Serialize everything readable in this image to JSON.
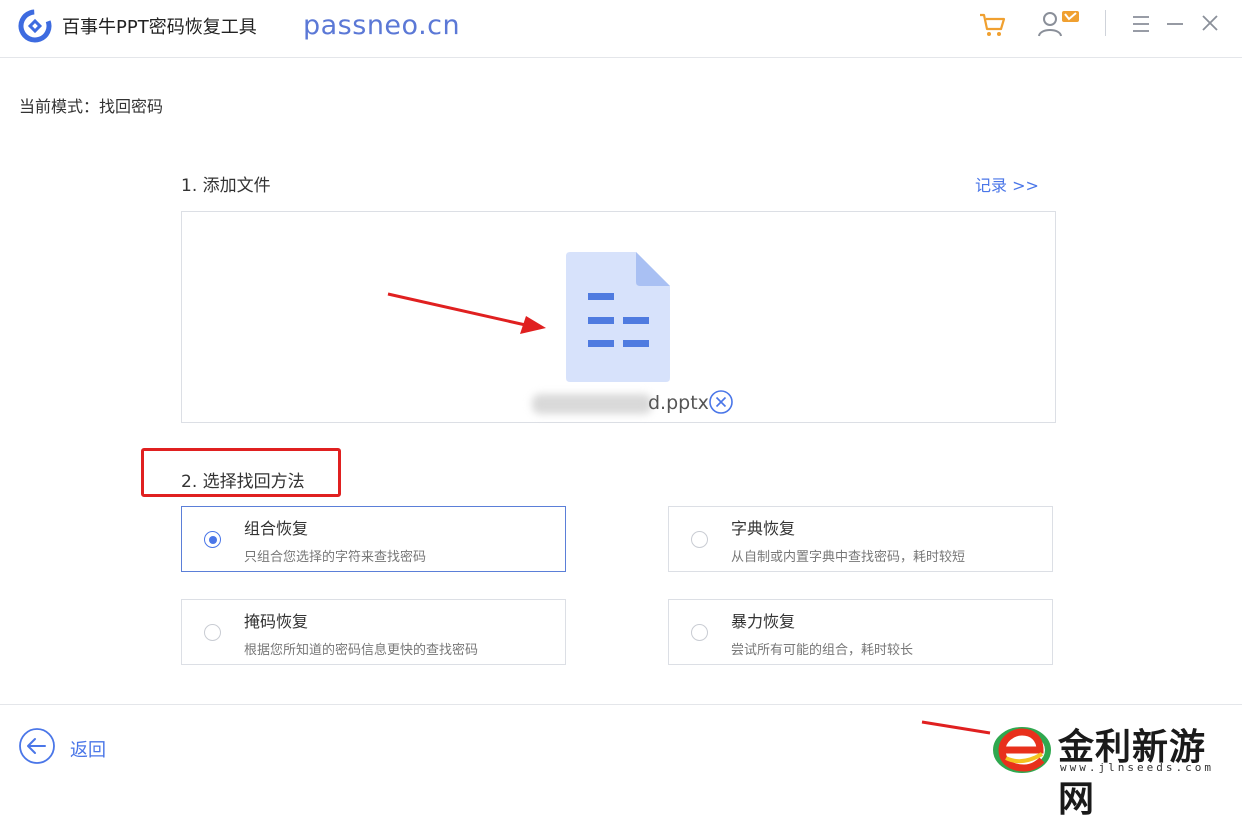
{
  "app": {
    "title": "百事牛PPT密码恢复工具",
    "watermark_url": "passneo.cn"
  },
  "toolbar": {
    "icons": [
      "cart-icon",
      "user-vip-icon",
      "menu-icon",
      "minimize-icon",
      "close-icon"
    ]
  },
  "mode": {
    "text": "当前模式：找回密码"
  },
  "step1": {
    "title": "1. 添加文件",
    "record_link": "记录 >>",
    "file_name": "d.pptx"
  },
  "step2": {
    "title": "2. 选择找回方法",
    "options": [
      {
        "title": "组合恢复",
        "desc": "只组合您选择的字符来查找密码",
        "selected": true
      },
      {
        "title": "字典恢复",
        "desc": "从自制或内置字典中查找密码，耗时较短",
        "selected": false
      },
      {
        "title": "掩码恢复",
        "desc": "根据您所知道的密码信息更快的查找密码",
        "selected": false
      },
      {
        "title": "暴力恢复",
        "desc": "尝试所有可能的组合，耗时较长",
        "selected": false
      }
    ]
  },
  "footer": {
    "back_label": "返回"
  },
  "watermark": {
    "name": "金利新游网",
    "site": "www.jlnseeds.com"
  },
  "colors": {
    "accent": "#4a76e8",
    "annotation": "#e02020",
    "cart": "#f0a030"
  }
}
